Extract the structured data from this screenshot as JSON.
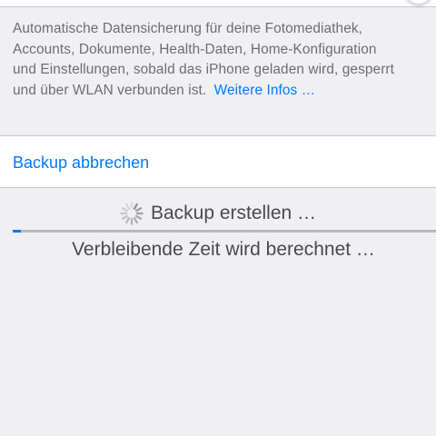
{
  "backup_section": {
    "footer_lines": [
      "Automatische Datensicherung für deine Fotomediathek,",
      "Accounts, Dokumente, Health-Daten, Home-Konfiguration",
      "und Einstellungen, sobald das iPhone geladen wird, gesperrt",
      "und über WLAN verbunden ist."
    ],
    "more_info_link": "Weitere Infos …"
  },
  "cancel_backup_label": "Backup abbrechen",
  "status": {
    "title": "Backup erstellen …",
    "remaining_time": "Verbleibende Zeit wird berechnet …",
    "progress_fraction": 0.02
  },
  "colors": {
    "accent": "#007aff",
    "background": "#efeff4",
    "secondary_text": "#6d6d72",
    "status_text": "#4a4a4e"
  },
  "icons": {
    "spinner": "activity-spinner-icon"
  }
}
